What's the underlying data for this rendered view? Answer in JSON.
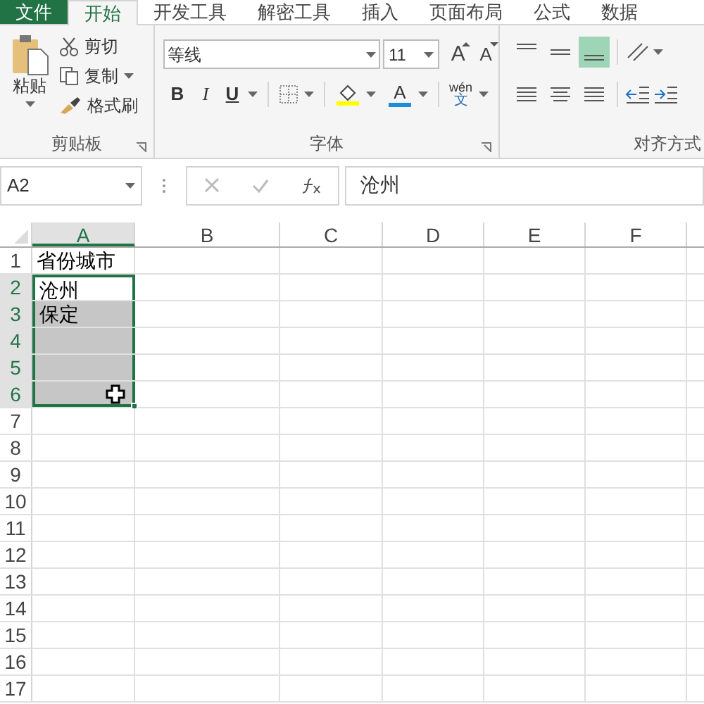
{
  "tabs": [
    {
      "label": "文件",
      "kind": "file",
      "selected": false
    },
    {
      "label": "开始",
      "kind": "tab",
      "selected": true
    },
    {
      "label": "开发工具",
      "kind": "tab",
      "selected": false
    },
    {
      "label": "解密工具",
      "kind": "tab",
      "selected": false
    },
    {
      "label": "插入",
      "kind": "tab",
      "selected": false
    },
    {
      "label": "页面布局",
      "kind": "tab",
      "selected": false
    },
    {
      "label": "公式",
      "kind": "tab",
      "selected": false
    },
    {
      "label": "数据",
      "kind": "tab",
      "selected": false
    }
  ],
  "clipboard": {
    "label": "剪贴板",
    "paste": "粘贴",
    "cut": "剪切",
    "copy": "复制",
    "format_painter": "格式刷"
  },
  "font": {
    "label": "字体",
    "name": "等线",
    "size": "11",
    "grow": "A",
    "shrink": "A",
    "bold": "B",
    "italic": "I",
    "underline": "U",
    "font_color": "A",
    "phonetic_top": "wén",
    "phonetic_bottom": "文"
  },
  "alignment": {
    "label": "对齐方式",
    "vertical": [
      {
        "selected": false
      },
      {
        "selected": false
      },
      {
        "selected": true
      }
    ]
  },
  "formula_bar": {
    "name_box": "A2",
    "value": "沧州"
  },
  "columns": [
    {
      "label": "A",
      "selected": true
    },
    {
      "label": "B",
      "selected": false
    },
    {
      "label": "C",
      "selected": false
    },
    {
      "label": "D",
      "selected": false
    },
    {
      "label": "E",
      "selected": false
    },
    {
      "label": "F",
      "selected": false
    }
  ],
  "rows": [
    {
      "label": "1",
      "selected": false,
      "active": false,
      "value": "省份城市"
    },
    {
      "label": "2",
      "selected": true,
      "active": true,
      "value": "沧州"
    },
    {
      "label": "3",
      "selected": true,
      "active": false,
      "value": "保定"
    },
    {
      "label": "4",
      "selected": true,
      "active": false
    },
    {
      "label": "5",
      "selected": true,
      "active": false
    },
    {
      "label": "6",
      "selected": true,
      "active": false
    },
    {
      "label": "7",
      "selected": false,
      "active": false
    },
    {
      "label": "8",
      "selected": false,
      "active": false
    },
    {
      "label": "9",
      "selected": false,
      "active": false
    },
    {
      "label": "10",
      "selected": false,
      "active": false
    },
    {
      "label": "11",
      "selected": false,
      "active": false
    },
    {
      "label": "12",
      "selected": false,
      "active": false
    },
    {
      "label": "13",
      "selected": false,
      "active": false
    },
    {
      "label": "14",
      "selected": false,
      "active": false
    },
    {
      "label": "15",
      "selected": false,
      "active": false
    },
    {
      "label": "16",
      "selected": false,
      "active": false
    },
    {
      "label": "17",
      "selected": false,
      "active": false
    }
  ]
}
